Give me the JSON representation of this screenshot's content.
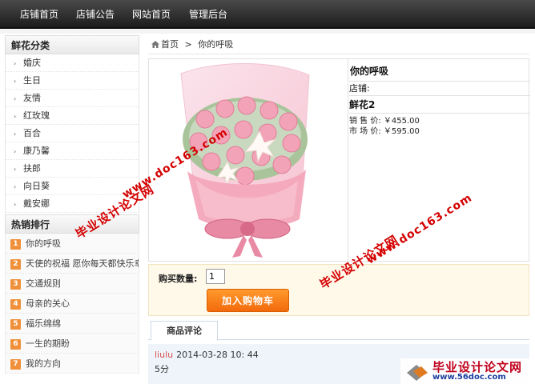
{
  "nav": {
    "items": [
      "店铺首页",
      "店铺公告",
      "网站首页",
      "管理后台"
    ]
  },
  "sidebar": {
    "category_title": "鲜花分类",
    "categories": [
      "婚庆",
      "生日",
      "友情",
      "红玫瑰",
      "百合",
      "康乃馨",
      "扶郎",
      "向日葵",
      "戴安娜"
    ],
    "hot_title": "热销排行",
    "hot_items": [
      {
        "rank": "1",
        "label": "你的呼吸"
      },
      {
        "rank": "2",
        "label": "天使的祝福 愿你每天都快乐幸福"
      },
      {
        "rank": "3",
        "label": "交通规则"
      },
      {
        "rank": "4",
        "label": "母亲的关心"
      },
      {
        "rank": "5",
        "label": "福乐绵绵"
      },
      {
        "rank": "6",
        "label": "一生的期盼"
      },
      {
        "rank": "7",
        "label": "我的方向"
      }
    ]
  },
  "breadcrumb": {
    "home": "首页",
    "separator": ">",
    "current": "你的呼吸"
  },
  "product": {
    "name": "你的呼吸",
    "shop_label": "店铺:",
    "title": "鲜花2",
    "sale_price": "销 售 价: ￥455.00",
    "market_price": "市 场 价: ￥595.00"
  },
  "buy": {
    "qty_label": "购买数量:",
    "qty_value": "1",
    "cart_button": "加入购物车"
  },
  "tabs": {
    "review": "商品评论"
  },
  "comment": {
    "user": "liulu",
    "time": "2014-03-28 10: 44",
    "score": "5分"
  },
  "watermark": {
    "text1": "毕业设计论文网",
    "url1": "www.doc163.com",
    "logo_text": "毕业设计论文网",
    "logo_url": "www.56doc.com"
  },
  "colors": {
    "accent": "#f26a0c",
    "watermark": "#d40000",
    "rank_badge": "#f0903a"
  }
}
